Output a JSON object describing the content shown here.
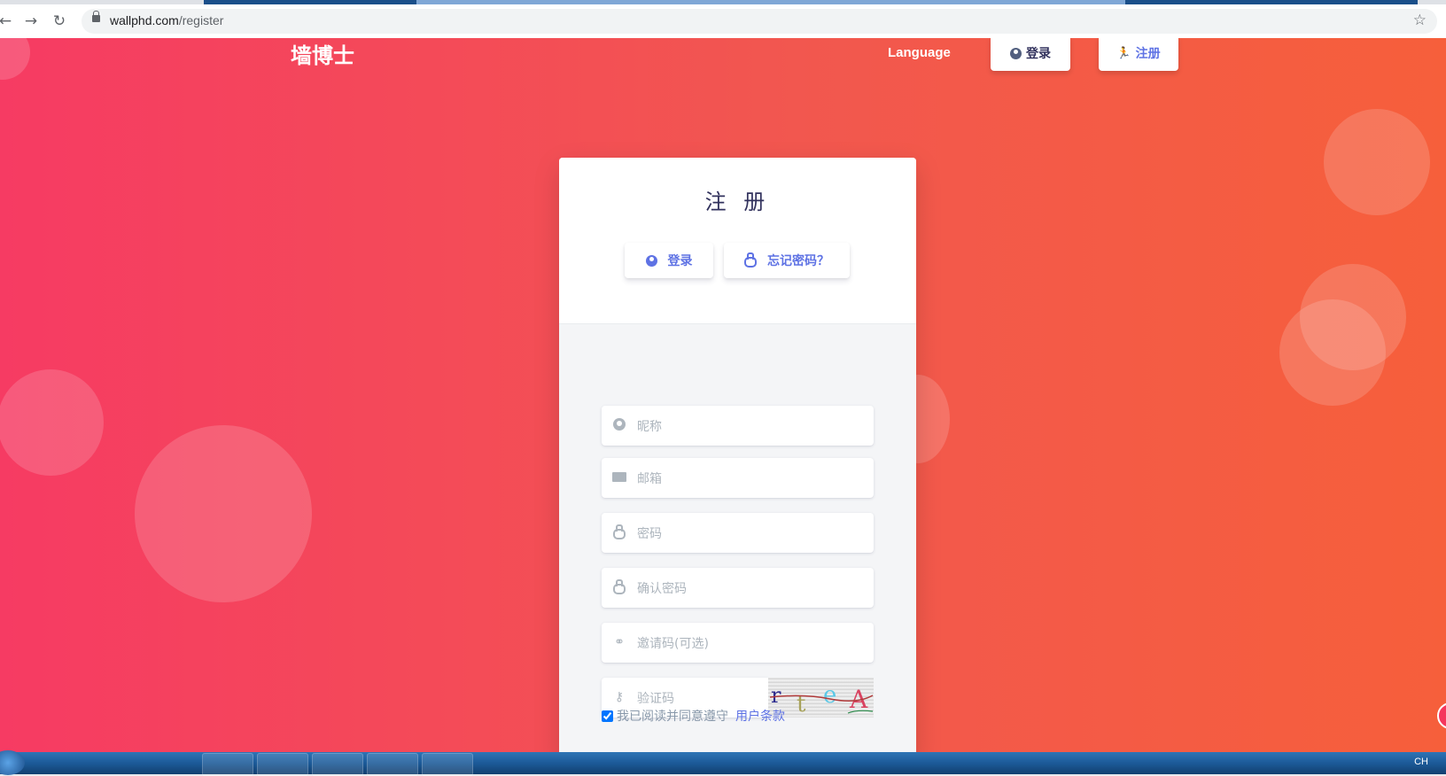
{
  "browser": {
    "url_domain": "wallphd.com",
    "url_path": "/register",
    "back_icon": "back-arrow-icon",
    "forward_icon": "forward-arrow-icon",
    "reload_icon": "reload-icon",
    "star_icon": "bookmark-star-icon"
  },
  "nav": {
    "brand": "墙博士",
    "language": "Language",
    "login": "登录",
    "register": "注册"
  },
  "card": {
    "title": "注 册",
    "login_button": "登录",
    "forgot_button": "忘记密码？",
    "fields": {
      "nickname_placeholder": "昵称",
      "email_placeholder": "邮箱",
      "password_placeholder": "密码",
      "confirm_placeholder": "确认密码",
      "invite_placeholder": "邀请码(可选)",
      "captcha_placeholder": "验证码"
    },
    "captcha_text": "rteA",
    "terms_text": "我已阅读并同意遵守",
    "terms_link": "用户条款",
    "terms_checked": true
  },
  "tray": {
    "ime": "CH"
  },
  "colors": {
    "accent": "#5e72e4",
    "bg_left": "#f63b63",
    "bg_right": "#f65f3b"
  }
}
